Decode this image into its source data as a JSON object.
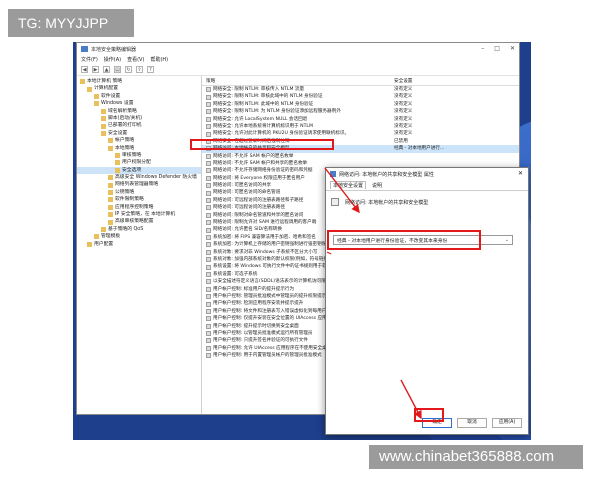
{
  "overlay": {
    "tg_label": "TG: MYYJJPP",
    "watermark": "www.chinabet365888.com"
  },
  "window": {
    "title": "本地安全策略编辑器",
    "menu": [
      "文件(F)",
      "操作(A)",
      "查看(V)",
      "帮助(H)"
    ],
    "toolbar_icons": [
      "back-icon",
      "forward-icon",
      "up-icon",
      "properties-icon",
      "refresh-icon",
      "export-icon",
      "help-icon"
    ]
  },
  "tree": {
    "items": [
      {
        "label": "本地计算机 策略",
        "indent": 0,
        "selected": false
      },
      {
        "label": "计算机配置",
        "indent": 1,
        "selected": false
      },
      {
        "label": "软件设置",
        "indent": 2,
        "selected": false
      },
      {
        "label": "Windows 设置",
        "indent": 2,
        "selected": false
      },
      {
        "label": "域名解析策略",
        "indent": 3,
        "selected": false
      },
      {
        "label": "脚本(启动/关机)",
        "indent": 3,
        "selected": false
      },
      {
        "label": "已部署的打印机",
        "indent": 3,
        "selected": false
      },
      {
        "label": "安全设置",
        "indent": 3,
        "selected": false
      },
      {
        "label": "帐户策略",
        "indent": 4,
        "selected": false
      },
      {
        "label": "本地策略",
        "indent": 4,
        "selected": false
      },
      {
        "label": "审核策略",
        "indent": 5,
        "selected": false
      },
      {
        "label": "用户权限分配",
        "indent": 5,
        "selected": false
      },
      {
        "label": "安全选项",
        "indent": 5,
        "selected": true
      },
      {
        "label": "高级安全 Windows Defender 防火墙",
        "indent": 4,
        "selected": false
      },
      {
        "label": "网络列表管理器策略",
        "indent": 4,
        "selected": false
      },
      {
        "label": "公钥策略",
        "indent": 4,
        "selected": false
      },
      {
        "label": "软件限制策略",
        "indent": 4,
        "selected": false
      },
      {
        "label": "应用程序控制策略",
        "indent": 4,
        "selected": false
      },
      {
        "label": "IP 安全策略，在 本地计算机",
        "indent": 4,
        "selected": false
      },
      {
        "label": "高级审核策略配置",
        "indent": 4,
        "selected": false
      },
      {
        "label": "基于策略的 QoS",
        "indent": 3,
        "selected": false
      },
      {
        "label": "管理模板",
        "indent": 2,
        "selected": false
      },
      {
        "label": "用户配置",
        "indent": 1,
        "selected": false
      }
    ]
  },
  "policy_list": {
    "col_policy": "策略",
    "col_setting": "安全设置",
    "rows": [
      {
        "name": "网络安全: 限制 NTLM: 审核传入 NTLM 流量",
        "value": "没有定义"
      },
      {
        "name": "网络安全: 限制 NTLM: 审核此域中的 NTLM 身份验证",
        "value": "没有定义"
      },
      {
        "name": "网络安全: 限制 NTLM: 此域中的 NTLM 身份验证",
        "value": "没有定义"
      },
      {
        "name": "网络安全: 限制 NTLM: 为 NTLM 身份验证添加远程服务器例外",
        "value": "没有定义"
      },
      {
        "name": "网络安全: 允许 LocalSystem NULL 会话回退",
        "value": "没有定义"
      },
      {
        "name": "网络安全: 允许本地系统将计算机标识用于 NTLM",
        "value": "没有定义"
      },
      {
        "name": "网络安全: 允许对此计算机的 PKU2U 身份验证请求使用联机标识。",
        "value": "没有定义"
      },
      {
        "name": "网络安全: 在超过登录时间后强制注销",
        "value": "已禁用"
      },
      {
        "name": "网络访问: 本地帐户的共享和安全模型",
        "value": "经典 - 对本地用户进行..."
      },
      {
        "name": "网络访问: 不允许 SAM 帐户的匿名枚举",
        "value": ""
      },
      {
        "name": "网络访问: 不允许 SAM 帐户和共享的匿名枚举",
        "value": ""
      },
      {
        "name": "网络访问: 不允许存储网络身份验证的密码和凭据",
        "value": ""
      },
      {
        "name": "网络访问: 将 Everyone 权限应用于匿名用户",
        "value": ""
      },
      {
        "name": "网络访问: 可匿名访问的共享",
        "value": ""
      },
      {
        "name": "网络访问: 可匿名访问的命名管道",
        "value": ""
      },
      {
        "name": "网络访问: 可远程访问的注册表路径和子路径",
        "value": ""
      },
      {
        "name": "网络访问: 可远程访问的注册表路径",
        "value": ""
      },
      {
        "name": "网络访问: 限制对命名管道和共享的匿名访问",
        "value": ""
      },
      {
        "name": "网络访问: 限制允许对 SAM 进行远程调用的客户端",
        "value": ""
      },
      {
        "name": "网络访问: 允许匿名 SID/名称转换",
        "value": ""
      },
      {
        "name": "系统加密: 将 FIPS 兼容算法用于加密、哈希和签名",
        "value": ""
      },
      {
        "name": "系统加密: 为计算机上存储的用户密钥强制进行强密钥保护",
        "value": ""
      },
      {
        "name": "系统对象: 要求对非 Windows 子系统不区分大小写",
        "value": ""
      },
      {
        "name": "系统对象: 加强内部系统对象的默认权限(例如，符号链接)",
        "value": ""
      },
      {
        "name": "系统设置: 将 Windows 可执行文件中的证书规则用于软件限制策略",
        "value": ""
      },
      {
        "name": "系统设置: 可选子系统",
        "value": ""
      },
      {
        "name": "以安全描述符定义语言(SDDL)语法表示的计算机访问限制",
        "value": ""
      },
      {
        "name": "用户帐户控制: 标准用户的提升提示行为",
        "value": ""
      },
      {
        "name": "用户帐户控制: 管理员批准模式中管理员的提升权限提示的行为",
        "value": ""
      },
      {
        "name": "用户帐户控制: 检测应用程序安装并提示提升",
        "value": ""
      },
      {
        "name": "用户帐户控制: 将文件和注册表写入错误虚拟化到每用户位置",
        "value": ""
      },
      {
        "name": "用户帐户控制: 仅提升安装在安全位置的 UIAccess 应用程序",
        "value": ""
      },
      {
        "name": "用户帐户控制: 提升提示时切换到安全桌面",
        "value": ""
      },
      {
        "name": "用户帐户控制: 以管理员批准模式运行所有管理员",
        "value": ""
      },
      {
        "name": "用户帐户控制: 只提升签名并验证的可执行文件",
        "value": ""
      },
      {
        "name": "用户帐户控制: 允许 UIAccess 应用程序在不使用安全桌面的情况下提升权限",
        "value": ""
      },
      {
        "name": "用户帐户控制: 用于内置管理员帐户的管理员批准模式",
        "value": ""
      }
    ]
  },
  "dialog": {
    "title": "网络访问: 本地帐户的共享和安全模型 属性",
    "tabs": [
      "本地安全设置",
      "说明"
    ],
    "policy_label": "网络访问: 本地帐户的共享和安全模型",
    "select_value": "经典 - 对本地用户进行身份验证，不改变其本来身份",
    "ok": "确定",
    "cancel": "取消",
    "apply": "应用(A)"
  },
  "colors": {
    "highlight_red": "#e2191b",
    "selection_blue": "#cde3f7",
    "desktop_blue": "#1d3f8c"
  }
}
